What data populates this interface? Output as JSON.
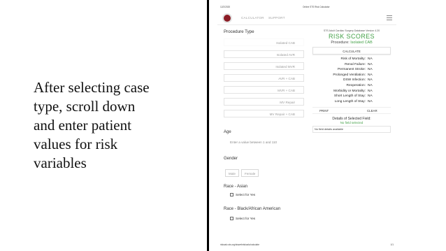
{
  "slide": {
    "caption_lines": [
      "After selecting case",
      "type, scroll down",
      "and enter patient",
      "values for risk",
      "variables"
    ]
  },
  "browser": {
    "date": "12/2/2020",
    "tab_title": "Online STS Risk Calculator",
    "url": "riskcalc.sts.org/stswebriskcalc/calculate",
    "page_count": "1/1"
  },
  "nav": {
    "calculator": "CALCULATOR",
    "support": "SUPPORT"
  },
  "procedure": {
    "title": "Procedure Type",
    "options": [
      "Isolated CAB",
      "Isolated AVR",
      "Isolated MVR",
      "AVR + CAB",
      "MVR + CAB",
      "MV Repair",
      "MV Repair + CAB"
    ]
  },
  "fields": {
    "age_label": "Age",
    "age_hint": "Enter a value between 1 and 110",
    "gender_label": "Gender",
    "gender_male": "Male",
    "gender_female": "Female",
    "race_asian_label": "Race - Asian",
    "race_asian_check": "Select for Yes",
    "race_black_label": "Race - Black/African American",
    "race_black_check": "Select for Yes"
  },
  "risk": {
    "db_version": "STS Adult Cardiac Surgery Database Version 4.20",
    "title": "RISK SCORES",
    "procedure_prefix": "Procedure:",
    "procedure_value": "Isolated CAB",
    "calculate": "CALCULATE",
    "rows": [
      {
        "label": "Risk of Mortality:",
        "value": "NA"
      },
      {
        "label": "Renal Failure:",
        "value": "NA"
      },
      {
        "label": "Permanent Stroke:",
        "value": "NA"
      },
      {
        "label": "Prolonged Ventilation:",
        "value": "NA"
      },
      {
        "label": "DSW Infection:",
        "value": "NA"
      },
      {
        "label": "Reoperation:",
        "value": "NA"
      },
      {
        "label": "Morbidity or Mortality:",
        "value": "NA"
      },
      {
        "label": "Short Length of Stay:",
        "value": "NA"
      },
      {
        "label": "Long Length of Stay:",
        "value": "NA"
      }
    ],
    "print": "PRINT",
    "clear": "CLEAR",
    "details_title": "Details of Selected Field:",
    "details_value": "No field selected",
    "details_box": "No field details available"
  },
  "colors": {
    "accent_green": "#43a047",
    "logo_red": "#8b1c25"
  }
}
